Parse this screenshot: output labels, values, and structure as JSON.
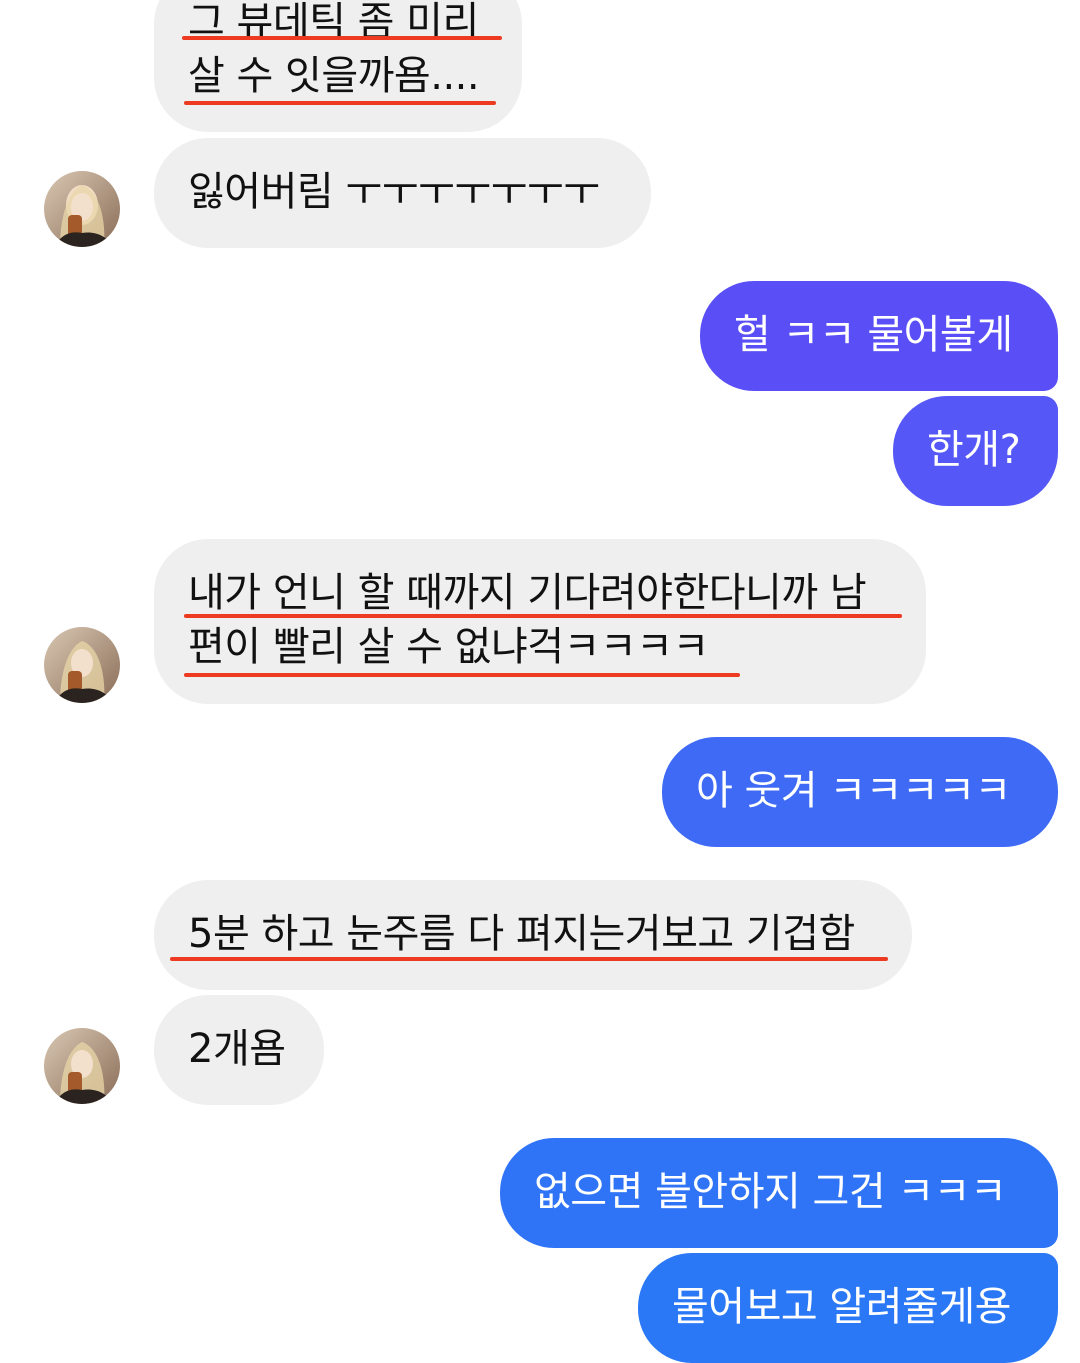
{
  "colors": {
    "incoming_bubble": "#efefef",
    "outgoing_gradient_top": "#6a45f6",
    "outgoing_gradient_mid": "#4a63f6",
    "outgoing_gradient_bottom": "#2f77f6",
    "highlight_underline": "#ee3a20"
  },
  "messages": [
    {
      "side": "incoming",
      "lines": [
        "그 뷰데틱 좀 미리",
        "살 수 잇을까욤...."
      ],
      "underlined": true
    },
    {
      "side": "incoming",
      "lines": [
        "잃어버림 ㅜㅜㅜㅜㅜㅜㅜ"
      ],
      "underlined": false,
      "avatar": "contact-avatar"
    },
    {
      "side": "outgoing",
      "lines": [
        "헐 ㅋㅋ 물어볼게"
      ]
    },
    {
      "side": "outgoing",
      "lines": [
        "한개?"
      ]
    },
    {
      "side": "incoming",
      "lines": [
        "내가 언니 할 때까지 기다려야한다니까 남",
        "편이 빨리 살 수 없냐걱ㅋㅋㅋㅋ"
      ],
      "underlined": true,
      "avatar": "contact-avatar"
    },
    {
      "side": "outgoing",
      "lines": [
        "아 웃겨 ㅋㅋㅋㅋㅋ"
      ]
    },
    {
      "side": "incoming",
      "lines": [
        "5분 하고 눈주름 다 펴지는거보고 기겁함"
      ],
      "underlined": true
    },
    {
      "side": "incoming",
      "lines": [
        "2개욤"
      ],
      "underlined": false,
      "avatar": "contact-avatar"
    },
    {
      "side": "outgoing",
      "lines": [
        "없으면 불안하지 그건 ㅋㅋㅋ"
      ]
    },
    {
      "side": "outgoing",
      "lines": [
        "물어보고 알려줄게용"
      ]
    }
  ]
}
